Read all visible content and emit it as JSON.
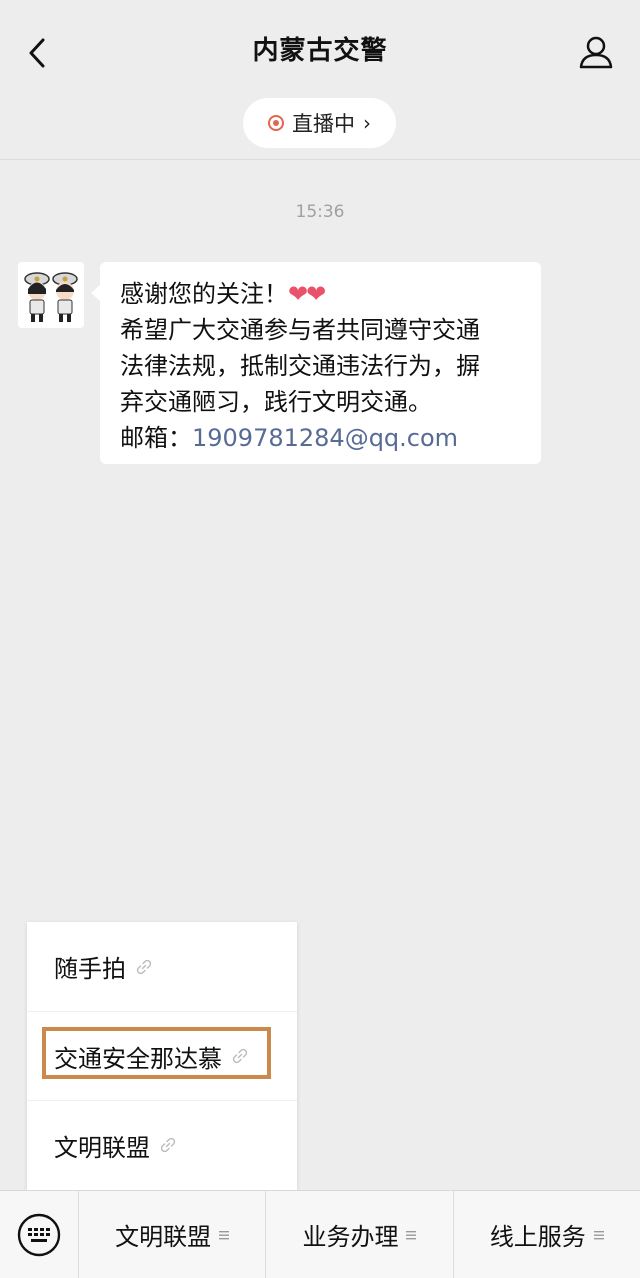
{
  "header": {
    "title": "内蒙古交警",
    "back_icon": "chevron-left-icon",
    "profile_icon": "person-icon",
    "live": {
      "label": "直播中",
      "chevron": "›",
      "dot_color": "#e2674f"
    }
  },
  "chat": {
    "timestamp": "15:36",
    "message": {
      "line1": "感谢您的关注！",
      "hearts": "❤❤",
      "line2": "希望广大交通参与者共同遵守交通",
      "line3": "法律法规，抵制交通违法行为，摒",
      "line4": "弃交通陋习，践行文明交通。",
      "email_label": "邮箱：",
      "email": "1909781284@qq.com"
    }
  },
  "popup_menu": {
    "items": [
      {
        "label": "随手拍",
        "icon": "link-icon"
      },
      {
        "label": "交通安全那达慕",
        "icon": "link-icon"
      },
      {
        "label": "文明联盟",
        "icon": "link-icon"
      }
    ],
    "highlight_color": "#c98a4b"
  },
  "bottom_menu": {
    "keyboard_icon": "keyboard-icon",
    "tabs": [
      {
        "label": "文明联盟",
        "icon": "menu-lines-icon"
      },
      {
        "label": "业务办理",
        "icon": "menu-lines-icon"
      },
      {
        "label": "线上服务",
        "icon": "menu-lines-icon"
      }
    ]
  },
  "colors": {
    "background": "#ededed",
    "link": "#576b95",
    "heart": "#e8526b"
  }
}
